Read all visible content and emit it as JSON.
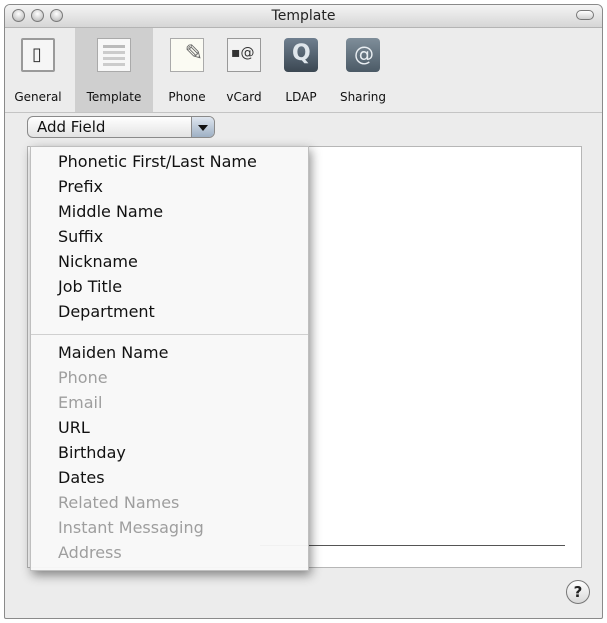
{
  "window": {
    "title": "Template"
  },
  "toolbar": {
    "items": [
      {
        "label": "General",
        "icon": "general-icon"
      },
      {
        "label": "Template",
        "icon": "template-icon",
        "selected": true
      },
      {
        "label": "Phone",
        "icon": "phone-icon"
      },
      {
        "label": "vCard",
        "icon": "vcard-icon"
      },
      {
        "label": "LDAP",
        "icon": "ldap-icon"
      },
      {
        "label": "Sharing",
        "icon": "sharing-icon"
      }
    ]
  },
  "add_field": {
    "label": "Add Field"
  },
  "menu": {
    "items": [
      {
        "label": "Phonetic First/Last Name",
        "enabled": true
      },
      {
        "label": "Prefix",
        "enabled": true
      },
      {
        "label": "Middle Name",
        "enabled": true
      },
      {
        "label": "Suffix",
        "enabled": true
      },
      {
        "label": "Nickname",
        "enabled": true
      },
      {
        "label": "Job Title",
        "enabled": true
      },
      {
        "label": "Department",
        "enabled": true
      },
      {
        "label": "Maiden Name",
        "enabled": true
      },
      {
        "label": "Phone",
        "enabled": false
      },
      {
        "label": "Email",
        "enabled": false
      },
      {
        "label": "URL",
        "enabled": true
      },
      {
        "label": "Birthday",
        "enabled": true
      },
      {
        "label": "Dates",
        "enabled": true
      },
      {
        "label": "Related Names",
        "enabled": false
      },
      {
        "label": "Instant Messaging",
        "enabled": false
      },
      {
        "label": "Address",
        "enabled": false
      }
    ]
  },
  "help": {
    "label": "?"
  }
}
